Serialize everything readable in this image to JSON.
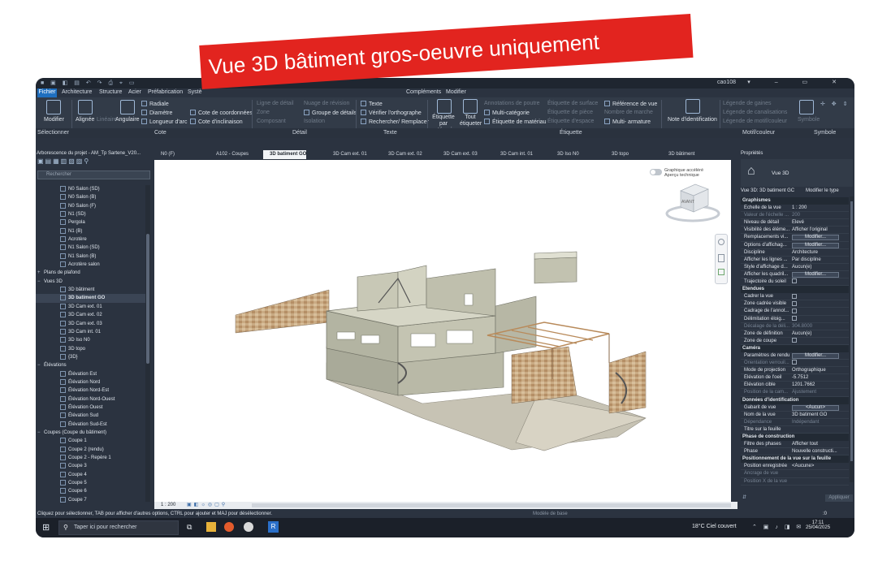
{
  "banner": {
    "title": "Vue 3D bâtiment gros-oeuvre uniquement"
  },
  "qat": {
    "user": "cao108"
  },
  "menu": {
    "tabs": [
      "Fichier",
      "Architecture",
      "Structure",
      "Acier",
      "Préfabrication",
      "Systè"
    ],
    "tab_right": [
      "Compléments",
      "Modifier"
    ]
  },
  "ribbon": {
    "modifier": "Modifier",
    "alignee": "Alignée",
    "lineaire": "Linéaire",
    "angulaire": "Angulaire",
    "radiale": "Radiale",
    "diametre": "Diamètre",
    "longueur_arc": "Longueur d'arc",
    "cote_coordonnees": "Cote de coordonnées",
    "cote_inclinaison": "Cote d'inclinaison",
    "ligne_detail": "Ligne de détail",
    "zone": "Zone",
    "composant": "Composant",
    "nuage_revision": "Nuage de révision",
    "groupe_details": "Groupe de détails",
    "isolation": "Isolation",
    "texte": "Texte",
    "verifier_ortho": "Vérifier l'orthographe",
    "rechercher_remplacer": "Rechercher/ Remplacer",
    "etiquette_categorie": "Étiquette par catégorie",
    "tout_etiqueter": "Tout étiqueter",
    "annotations_poutre": "Annotations de poutre",
    "multi_categorie": "Multi-catégorie",
    "etiquette_materiau": "Étiquette de matériau",
    "etiquette_surface": "Étiquette de surface",
    "etiquette_piece": "Étiquette de pièce",
    "etiquette_espace": "Étiquette d'espace",
    "reference_vue": "Référence de vue",
    "nombre_marche": "Nombre de marche",
    "multi_armature": "Multi- armature",
    "note_identification": "Note d'identification",
    "legende_gaines": "Légende de gaines",
    "legende_canalisations": "Légende de canalisations",
    "legende_motif": "Légende de motif/couleur",
    "symbole": "Symbole",
    "panels": [
      "Sélectionner",
      "Cote",
      "Détail",
      "Texte",
      "Étiquette",
      "Motif/couleur",
      "Symbole"
    ]
  },
  "browser": {
    "title": "Arborescence du projet - AM_Tp Sartene_V20...",
    "search_placeholder": "Rechercher",
    "items": [
      {
        "label": "N0 Salon (SD)",
        "level": 3,
        "sel": false
      },
      {
        "label": "N0 Salon (B)",
        "level": 3,
        "sel": false
      },
      {
        "label": "N0 Salon (F)",
        "level": 3,
        "sel": false
      },
      {
        "label": "N1 (SD)",
        "level": 3,
        "sel": false
      },
      {
        "label": "Pergola",
        "level": 3,
        "sel": false
      },
      {
        "label": "N1 (B)",
        "level": 3,
        "sel": false
      },
      {
        "label": "Acrotère",
        "level": 3,
        "sel": false
      },
      {
        "label": "N1 Salon (SD)",
        "level": 3,
        "sel": false
      },
      {
        "label": "N1 Salon (B)",
        "level": 3,
        "sel": false
      },
      {
        "label": "Acrotère salon",
        "level": 3,
        "sel": false
      },
      {
        "label": "Plans de plafond",
        "level": 1,
        "sel": false,
        "exp": "+"
      },
      {
        "label": "Vues 3D",
        "level": 1,
        "sel": false,
        "exp": "−"
      },
      {
        "label": "3D bâtiment",
        "level": 3,
        "sel": false
      },
      {
        "label": "3D batiment GO",
        "level": 3,
        "sel": true
      },
      {
        "label": "3D Cam ext. 01",
        "level": 3,
        "sel": false
      },
      {
        "label": "3D Cam ext. 02",
        "level": 3,
        "sel": false
      },
      {
        "label": "3D Cam ext. 03",
        "level": 3,
        "sel": false
      },
      {
        "label": "3D Cam int. 01",
        "level": 3,
        "sel": false
      },
      {
        "label": "3D Iso N0",
        "level": 3,
        "sel": false
      },
      {
        "label": "3D topo",
        "level": 3,
        "sel": false
      },
      {
        "label": "{3D}",
        "level": 3,
        "sel": false
      },
      {
        "label": "Élévations",
        "level": 1,
        "sel": false,
        "exp": "−"
      },
      {
        "label": "Élévation Est",
        "level": 3,
        "sel": false
      },
      {
        "label": "Élévation Nord",
        "level": 3,
        "sel": false
      },
      {
        "label": "Élévation Nord-Est",
        "level": 3,
        "sel": false
      },
      {
        "label": "Élévation Nord-Ouest",
        "level": 3,
        "sel": false
      },
      {
        "label": "Élévation Ouest",
        "level": 3,
        "sel": false
      },
      {
        "label": "Élévation Sud",
        "level": 3,
        "sel": false
      },
      {
        "label": "Élévation Sud-Est",
        "level": 3,
        "sel": false
      },
      {
        "label": "Coupes (Coupe du bâtiment)",
        "level": 1,
        "sel": false,
        "exp": "−"
      },
      {
        "label": "Coupe 1",
        "level": 3,
        "sel": false
      },
      {
        "label": "Coupe 2 (rendu)",
        "level": 3,
        "sel": false
      },
      {
        "label": "Coupe 2 - Repère 1",
        "level": 3,
        "sel": false
      },
      {
        "label": "Coupe 3",
        "level": 3,
        "sel": false
      },
      {
        "label": "Coupe 4",
        "level": 3,
        "sel": false
      },
      {
        "label": "Coupe 5",
        "level": 3,
        "sel": false
      },
      {
        "label": "Coupe 6",
        "level": 3,
        "sel": false
      },
      {
        "label": "Coupe 7",
        "level": 3,
        "sel": false
      }
    ]
  },
  "doctabs": [
    {
      "label": "N0 (F)",
      "active": false
    },
    {
      "label": "A102 - Coupes",
      "active": false
    },
    {
      "label": "3D batiment GO",
      "active": true
    },
    {
      "label": "3D Cam ext. 01",
      "active": false
    },
    {
      "label": "3D Cam ext. 02",
      "active": false
    },
    {
      "label": "3D Cam ext. 03",
      "active": false
    },
    {
      "label": "3D Cam int. 01",
      "active": false
    },
    {
      "label": "3D Iso N0",
      "active": false
    },
    {
      "label": "3D topo",
      "active": false
    },
    {
      "label": "3D bâtiment",
      "active": false
    }
  ],
  "viewport": {
    "toggle_line1": "Graphique accéléré",
    "toggle_line2": "Aperçu technique",
    "viewcube": "AVANT",
    "scale": "1 : 200"
  },
  "properties": {
    "title": "Propriétés",
    "type": "Vue 3D",
    "view_selector": "Vue 3D: 3D batiment GC",
    "edit_type": "Modifier le type",
    "rows": [
      {
        "cat": "Graphismes"
      },
      {
        "k": "Échelle de la vue",
        "v": "1 : 200"
      },
      {
        "k": "Valeur de l'échelle ...",
        "v": "200",
        "dis": true
      },
      {
        "k": "Niveau de détail",
        "v": "Elevé"
      },
      {
        "k": "Visibilité des éléme...",
        "v": "Afficher l'original"
      },
      {
        "k": "Remplacements vi...",
        "btn": "Modifier..."
      },
      {
        "k": "Options d'affichag...",
        "btn": "Modifier..."
      },
      {
        "k": "Discipline",
        "v": "Architecture"
      },
      {
        "k": "Afficher les lignes ...",
        "v": "Par discipline"
      },
      {
        "k": "Style d'affichage d...",
        "v": "Aucun(e)"
      },
      {
        "k": "Afficher les quadril...",
        "btn": "Modifier..."
      },
      {
        "k": "Trajectoire du soleil",
        "chk": true
      },
      {
        "cat": "Etendues"
      },
      {
        "k": "Cadrer la vue",
        "chk": true
      },
      {
        "k": "Zone cadrée visible",
        "chk": true
      },
      {
        "k": "Cadrage de l'annot...",
        "chk": true
      },
      {
        "k": "Délimitation éloig...",
        "chk": true
      },
      {
        "k": "Décalage de la déli...",
        "v": "304.8000",
        "dis": true
      },
      {
        "k": "Zone de définition",
        "v": "Aucun(e)"
      },
      {
        "k": "Zone de coupe",
        "chk": true
      },
      {
        "cat": "Caméra"
      },
      {
        "k": "Paramètres de rendu",
        "btn": "Modifier..."
      },
      {
        "k": "Orientation verrouil...",
        "chk": false,
        "dis": true
      },
      {
        "k": "Mode de projection",
        "v": "Orthographique"
      },
      {
        "k": "Élévation de l'oeil",
        "v": "-5.7512"
      },
      {
        "k": "Élévation cible",
        "v": "1201.7662"
      },
      {
        "k": "Position de la cam...",
        "v": "Ajustement",
        "dis": true
      },
      {
        "cat": "Données d'identification"
      },
      {
        "k": "Gabarit de vue",
        "btn": "<Aucun>"
      },
      {
        "k": "Nom de la vue",
        "v": "3D batiment GO"
      },
      {
        "k": "Dépendance",
        "v": "Indépendant",
        "dis": true
      },
      {
        "k": "Titre sur la feuille",
        "v": ""
      },
      {
        "cat": "Phase de construction"
      },
      {
        "k": "Filtre des phases",
        "v": "Afficher tout"
      },
      {
        "k": "Phase",
        "v": "Nouvelle constructi..."
      },
      {
        "cat": "Positionnement de la vue sur la feuille"
      },
      {
        "k": "Position enregistrée",
        "v": "<Aucune>"
      },
      {
        "k": "Ancrage de vue",
        "v": "",
        "dis": true
      },
      {
        "k": "Position X de la vue",
        "v": "",
        "dis": true
      }
    ],
    "apply": "Appliquer"
  },
  "status": {
    "message": "Cliquez pour sélectionner, TAB pour afficher d'autres options, CTRL pour ajouter et MAJ pour désélectionner.",
    "model": "Modèle de base",
    "right": ":0"
  },
  "taskbar": {
    "search": "Taper ici pour rechercher",
    "weather": "18°C  Ciel couvert",
    "time": "17:11",
    "date": "25/04/2025"
  },
  "colors": {
    "banner": "#e2241f",
    "ribbon": "#323b48",
    "panel": "#2b3340",
    "active_tab": "#1f6fbf"
  }
}
